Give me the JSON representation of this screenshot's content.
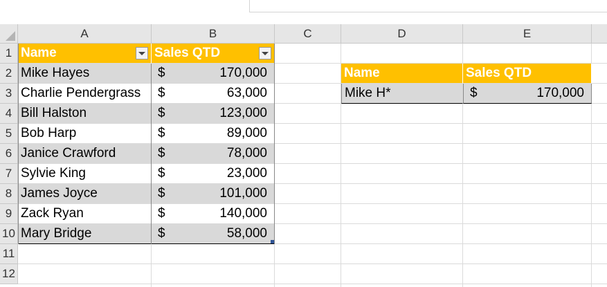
{
  "columns": [
    "A",
    "B",
    "C",
    "D",
    "E"
  ],
  "rows": [
    "1",
    "2",
    "3",
    "4",
    "5",
    "6",
    "7",
    "8",
    "9",
    "10",
    "11",
    "12"
  ],
  "table": {
    "headers": [
      "Name",
      "Sales QTD"
    ],
    "rows": [
      {
        "name": "Mike Hayes",
        "currency": "$",
        "amount": "170,000"
      },
      {
        "name": "Charlie Pendergrass",
        "currency": "$",
        "amount": "63,000"
      },
      {
        "name": "Bill Halston",
        "currency": "$",
        "amount": "123,000"
      },
      {
        "name": "Bob Harp",
        "currency": "$",
        "amount": "89,000"
      },
      {
        "name": "Janice Crawford",
        "currency": "$",
        "amount": "78,000"
      },
      {
        "name": "Sylvie King",
        "currency": "$",
        "amount": "23,000"
      },
      {
        "name": "James Joyce",
        "currency": "$",
        "amount": "101,000"
      },
      {
        "name": "Zack Ryan",
        "currency": "$",
        "amount": "140,000"
      },
      {
        "name": "Mary Bridge",
        "currency": "$",
        "amount": "58,000"
      }
    ]
  },
  "lookup": {
    "headers": [
      "Name",
      "Sales QTD"
    ],
    "name": "Mike H*",
    "currency": "$",
    "amount": "170,000"
  },
  "colors": {
    "header_fill": "#ffc000",
    "band_fill": "#d9d9d9"
  }
}
